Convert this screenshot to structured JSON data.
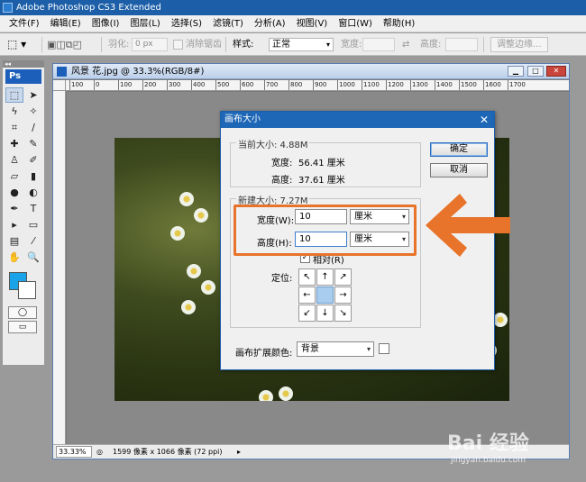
{
  "app": {
    "title": "Adobe Photoshop CS3 Extended"
  },
  "menu": [
    "文件(F)",
    "编辑(E)",
    "图像(I)",
    "图层(L)",
    "选择(S)",
    "滤镜(T)",
    "分析(A)",
    "视图(V)",
    "窗口(W)",
    "帮助(H)"
  ],
  "options": {
    "feather_label": "羽化:",
    "feather_value": "0 px",
    "antialias_label": "消除锯齿",
    "style_label": "样式:",
    "style_value": "正常",
    "width_label": "宽度:",
    "height_label": "高度:",
    "refine_label": "调整边缘..."
  },
  "toolbox": {
    "logo": "Ps"
  },
  "document": {
    "title": "风景 花.jpg @ 33.3%(RGB/8#)",
    "ruler_ticks": [
      "100",
      "0",
      "100",
      "200",
      "300",
      "400",
      "500",
      "600",
      "700",
      "800",
      "900",
      "1000",
      "1100",
      "1200",
      "1300",
      "1400",
      "1500",
      "1600",
      "1700"
    ],
    "zoom": "33.33%",
    "status": "1599 像素 x 1066 像素 (72 ppi)"
  },
  "dialog": {
    "title": "画布大小",
    "ok_label": "确定",
    "cancel_label": "取消",
    "current_group": "当前大小: 4.88M",
    "current_width_label": "宽度:",
    "current_width_value": "56.41 厘米",
    "current_height_label": "高度:",
    "current_height_value": "37.61 厘米",
    "new_group": "新建大小: 7.27M",
    "new_width_label": "宽度(W):",
    "new_width_value": "10",
    "new_width_unit": "厘米",
    "new_height_label": "高度(H):",
    "new_height_value": "10",
    "new_height_unit": "厘米",
    "relative_label": "相对(R)",
    "relative_checked": true,
    "anchor_label": "定位:",
    "anchor_arrows": [
      "↖",
      "↑",
      "↗",
      "←",
      "",
      "→",
      "↙",
      "↓",
      "↘"
    ],
    "extension_label": "画布扩展颜色:",
    "extension_value": "背景"
  },
  "annotation": {
    "highlight_color": "#e8732a",
    "arrow_color": "#e8732a"
  },
  "watermark": {
    "main": "Bai 经验",
    "sub": "jingyan.baidu.com"
  }
}
